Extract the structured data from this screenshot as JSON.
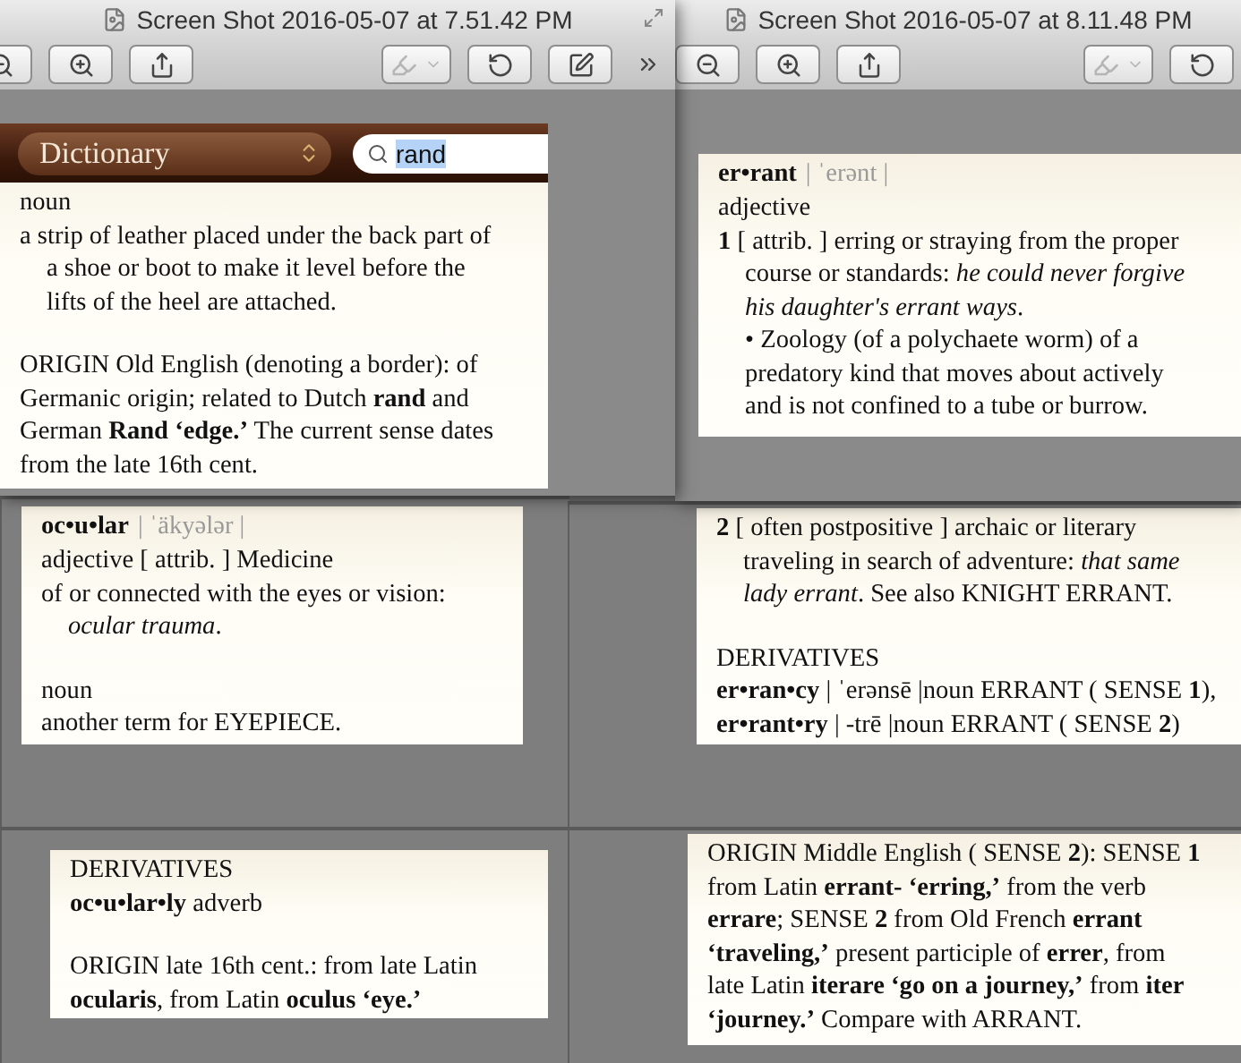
{
  "windows": [
    {
      "title": "Screen Shot 2016-05-07 at 7.51.42 PM",
      "toolbar": [
        {
          "kind": "zoom-out",
          "disabled": false
        },
        {
          "kind": "zoom-in",
          "disabled": false
        },
        {
          "kind": "share",
          "disabled": false
        },
        {
          "kind": "markup",
          "disabled": true
        },
        {
          "kind": "rotate",
          "disabled": false
        },
        {
          "kind": "edit",
          "disabled": false
        },
        {
          "kind": "more",
          "disabled": false
        }
      ],
      "document": {
        "header": {
          "source": "Dictionary",
          "search": "rand",
          "search_selected": true
        },
        "lines": [
          {
            "kind": "line",
            "text": "noun"
          },
          {
            "kind": "line",
            "text": "a strip of leather placed under the back part of"
          },
          {
            "kind": "indented",
            "text": "a shoe or boot to make it level before the"
          },
          {
            "kind": "indented",
            "text": "lifts of the heel are attached."
          },
          {
            "kind": "spaced",
            "text": "ORIGIN Old English (denoting a border): of"
          },
          {
            "kind": "line",
            "text": "Germanic origin; related to Dutch **rand** and"
          },
          {
            "kind": "line",
            "text": "German **Rand ‘edge.’** The current sense dates"
          },
          {
            "kind": "line",
            "text": "from the late 16th cent."
          }
        ]
      }
    },
    {
      "title": "Screen Shot 2016-05-07 at 8.11.48 PM",
      "toolbar": [
        {
          "kind": "zoom-out",
          "disabled": false
        },
        {
          "kind": "zoom-in",
          "disabled": false
        },
        {
          "kind": "share",
          "disabled": false
        },
        {
          "kind": "markup",
          "disabled": true
        },
        {
          "kind": "rotate",
          "disabled": false
        }
      ],
      "document": {
        "lines": [
          {
            "kind": "headword",
            "word": "er•rant",
            "pronunciation": "| ˈerənt |"
          },
          {
            "kind": "line",
            "text": "adjective"
          },
          {
            "kind": "line",
            "text": "**1** [ attrib. ] erring or straying from the proper"
          },
          {
            "kind": "indented",
            "text": "course or standards: *he could never forgive*"
          },
          {
            "kind": "indented",
            "text": "*his daughter's errant ways*."
          },
          {
            "kind": "indented",
            "text": "• Zoology (of a polychaete worm) of a"
          },
          {
            "kind": "indented",
            "text": "predatory kind that moves about actively"
          },
          {
            "kind": "indented",
            "text": "and is not confined to a tube or burrow."
          }
        ]
      }
    }
  ],
  "pages": [
    {
      "lines": [
        {
          "kind": "headword",
          "word": "oc•u•lar",
          "pronunciation": "| ˈäkyələr |"
        },
        {
          "kind": "line",
          "text": "adjective   [ attrib. ]  Medicine"
        },
        {
          "kind": "line",
          "text": "of or connected with the eyes or vision:"
        },
        {
          "kind": "indented",
          "text": "*ocular trauma*."
        },
        {
          "kind": "spaced",
          "text": "noun"
        },
        {
          "kind": "line",
          "text": "another term for EYEPIECE."
        }
      ]
    },
    {
      "lines": [
        {
          "kind": "line",
          "text": "**2** [ often postpositive ] archaic or literary"
        },
        {
          "kind": "indented",
          "text": "traveling in search of adventure: *that same*"
        },
        {
          "kind": "indented",
          "text": "*lady errant*. See also KNIGHT ERRANT."
        },
        {
          "kind": "spaced",
          "text": "DERIVATIVES"
        },
        {
          "kind": "line",
          "text": "**er•ran•cy** | ˈerənsē |noun  ERRANT ( SENSE **1**),"
        },
        {
          "kind": "line",
          "text": "**er•rant•ry** | -trē |noun  ERRANT ( SENSE **2**)"
        }
      ]
    },
    {
      "lines": [
        {
          "kind": "line",
          "text": "DERIVATIVES"
        },
        {
          "kind": "line",
          "text": "**oc•u•lar•ly** adverb"
        },
        {
          "kind": "spaced",
          "text": "ORIGIN late 16th cent.: from late Latin"
        },
        {
          "kind": "line",
          "text": "**ocularis**, from Latin **oculus ‘eye.’**"
        }
      ]
    },
    {
      "lines": [
        {
          "kind": "line",
          "text": "ORIGIN Middle English ( SENSE **2**): SENSE **1**"
        },
        {
          "kind": "line",
          "text": "from Latin **errant- ‘erring,’** from the verb"
        },
        {
          "kind": "line",
          "text": "**errare**; SENSE **2** from Old French **errant**"
        },
        {
          "kind": "line",
          "text": "**‘traveling,’** present participle of **errer**, from"
        },
        {
          "kind": "line",
          "text": "late Latin **iterare ‘go on a journey,’** from **iter**"
        },
        {
          "kind": "line",
          "text": "**‘journey.’** Compare with ARRANT."
        }
      ]
    }
  ]
}
